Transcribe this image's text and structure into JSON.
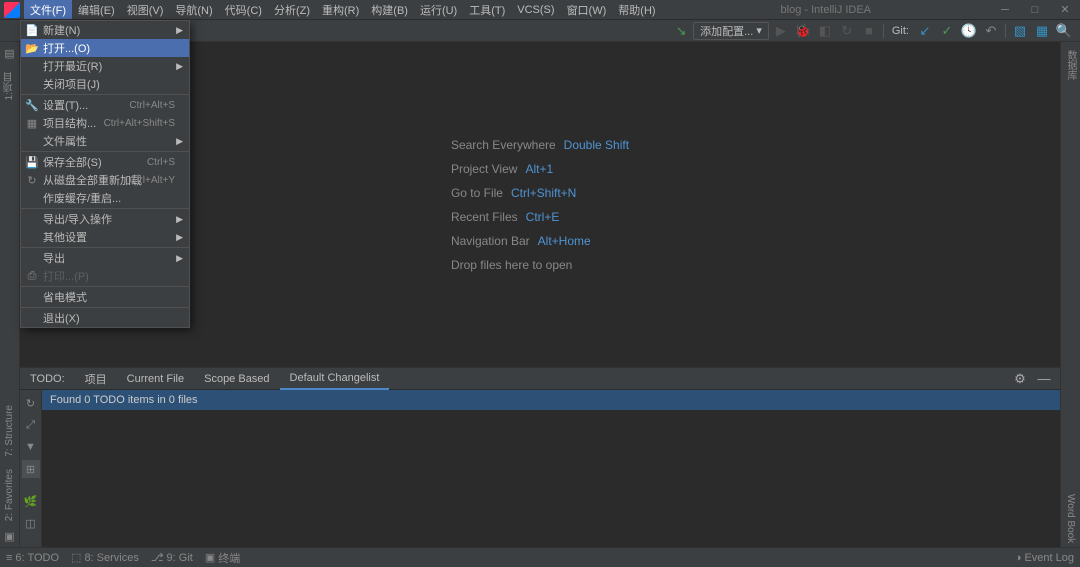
{
  "window_title": "blog - IntelliJ IDEA",
  "menu": [
    "文件(F)",
    "编辑(E)",
    "视图(V)",
    "导航(N)",
    "代码(C)",
    "分析(Z)",
    "重构(R)",
    "构建(B)",
    "运行(U)",
    "工具(T)",
    "VCS(S)",
    "窗口(W)",
    "帮助(H)"
  ],
  "active_menu_index": 0,
  "run_config_label": "添加配置...",
  "git_label": "Git:",
  "file_menu": [
    {
      "type": "item",
      "label": "新建(N)",
      "icon": "📄",
      "arrow": true
    },
    {
      "type": "item",
      "label": "打开...(O)",
      "icon": "📂",
      "selected": true
    },
    {
      "type": "item",
      "label": "打开最近(R)",
      "arrow": true
    },
    {
      "type": "item",
      "label": "关闭项目(J)"
    },
    {
      "type": "sep"
    },
    {
      "type": "item",
      "label": "设置(T)...",
      "icon": "🔧",
      "shortcut": "Ctrl+Alt+S"
    },
    {
      "type": "item",
      "label": "项目结构...",
      "icon": "▦",
      "shortcut": "Ctrl+Alt+Shift+S"
    },
    {
      "type": "item",
      "label": "文件属性",
      "arrow": true
    },
    {
      "type": "sep"
    },
    {
      "type": "item",
      "label": "保存全部(S)",
      "icon": "💾",
      "shortcut": "Ctrl+S"
    },
    {
      "type": "item",
      "label": "从磁盘全部重新加载",
      "icon": "↻",
      "shortcut": "Ctrl+Alt+Y"
    },
    {
      "type": "item",
      "label": "作废缓存/重启..."
    },
    {
      "type": "sep"
    },
    {
      "type": "item",
      "label": "导出/导入操作",
      "arrow": true
    },
    {
      "type": "item",
      "label": "其他设置",
      "arrow": true
    },
    {
      "type": "sep"
    },
    {
      "type": "item",
      "label": "导出",
      "arrow": true
    },
    {
      "type": "item",
      "label": "打印...(P)",
      "icon": "⎙",
      "disabled": true
    },
    {
      "type": "sep"
    },
    {
      "type": "item",
      "label": "省电模式"
    },
    {
      "type": "sep"
    },
    {
      "type": "item",
      "label": "退出(X)"
    }
  ],
  "hints": [
    {
      "text": "Search Everywhere",
      "key": "Double Shift"
    },
    {
      "text": "Project View",
      "key": "Alt+1"
    },
    {
      "text": "Go to File",
      "key": "Ctrl+Shift+N"
    },
    {
      "text": "Recent Files",
      "key": "Ctrl+E"
    },
    {
      "text": "Navigation Bar",
      "key": "Alt+Home"
    },
    {
      "text": "Drop files here to open",
      "key": ""
    }
  ],
  "left_gutter": {
    "top": [
      "1:项目"
    ],
    "bottom": [
      "7: Structure",
      "2: Favorites"
    ]
  },
  "right_gutter": {
    "top": [
      "数据库"
    ],
    "bottom": [
      "Word Book"
    ]
  },
  "todo": {
    "title": "TODO:",
    "tabs": [
      "项目",
      "Current File",
      "Scope Based",
      "Default Changelist"
    ],
    "active_tab": 3,
    "found": "Found 0 TODO items in 0 files"
  },
  "status": {
    "left": [
      {
        "label": "6: TODO",
        "icon": "≡"
      },
      {
        "label": "8: Services",
        "icon": "⬚"
      },
      {
        "label": "9: Git",
        "icon": "⎇"
      },
      {
        "label": "终端",
        "icon": "▣"
      }
    ],
    "right": {
      "label": "Event Log",
      "icon": "◑"
    }
  },
  "colors": {
    "accent": "#4b6eaf",
    "link": "#4f94d4",
    "bg": "#2b2b2b",
    "panel": "#3c3f41"
  }
}
